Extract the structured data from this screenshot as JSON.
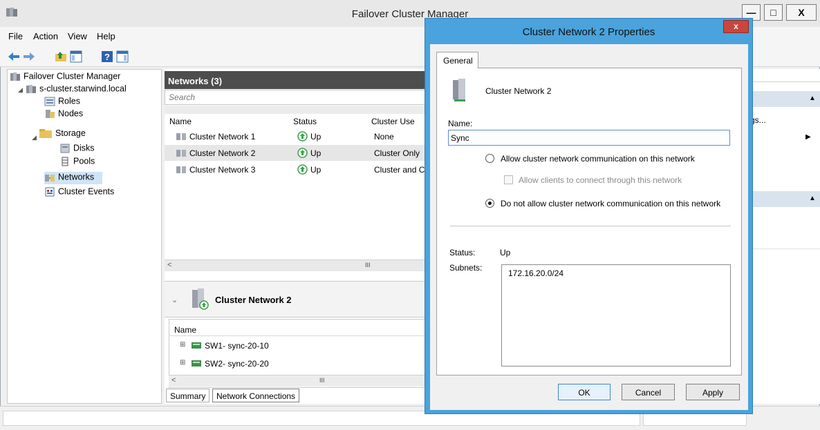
{
  "window": {
    "title": "Failover Cluster Manager",
    "minimize": "—",
    "maximize": "□",
    "close": "X"
  },
  "menu": [
    "File",
    "Action",
    "View",
    "Help"
  ],
  "tree": {
    "root": "Failover Cluster Manager",
    "cluster": "s-cluster.starwind.local",
    "roles": "Roles",
    "nodes": "Nodes",
    "storage": "Storage",
    "disks": "Disks",
    "pools": "Pools",
    "networks": "Networks",
    "events": "Cluster Events"
  },
  "networks_panel": {
    "header": "Networks (3)",
    "search_placeholder": "Search",
    "columns": [
      "Name",
      "Status",
      "Cluster Use"
    ],
    "rows": [
      {
        "name": "Cluster Network 1",
        "status": "Up",
        "use": "None"
      },
      {
        "name": "Cluster Network 2",
        "status": "Up",
        "use": "Cluster Only"
      },
      {
        "name": "Cluster Network 3",
        "status": "Up",
        "use": "Cluster and Cl"
      }
    ],
    "scroll_glyph": "III"
  },
  "detail": {
    "title": "Cluster Network 2",
    "column": "Name",
    "items": [
      "SW1- sync-20-10",
      "SW2- sync-20-20"
    ],
    "scroll_glyph": "III",
    "tabs": [
      "Summary",
      "Network Connections"
    ]
  },
  "actions": {
    "item1": "gs..."
  },
  "dialog": {
    "title": "Cluster Network 2 Properties",
    "close": "x",
    "tab": "General",
    "network_name": "Cluster Network 2",
    "name_label": "Name:",
    "name_value": "Sync",
    "radio_allow": "Allow cluster network communication on this network",
    "check_clients": "Allow clients to connect through this network",
    "radio_deny": "Do not allow cluster network communication on this network",
    "status_label": "Status:",
    "status_value": "Up",
    "subnets_label": "Subnets:",
    "subnets": [
      "172.16.20.0/24"
    ],
    "ok": "OK",
    "cancel": "Cancel",
    "apply": "Apply"
  },
  "colors": {
    "dialog_border": "#4aa3dc",
    "header_dark": "#4d4d4d",
    "selection": "#cfe4f7",
    "status_up": "#3aa04a"
  }
}
